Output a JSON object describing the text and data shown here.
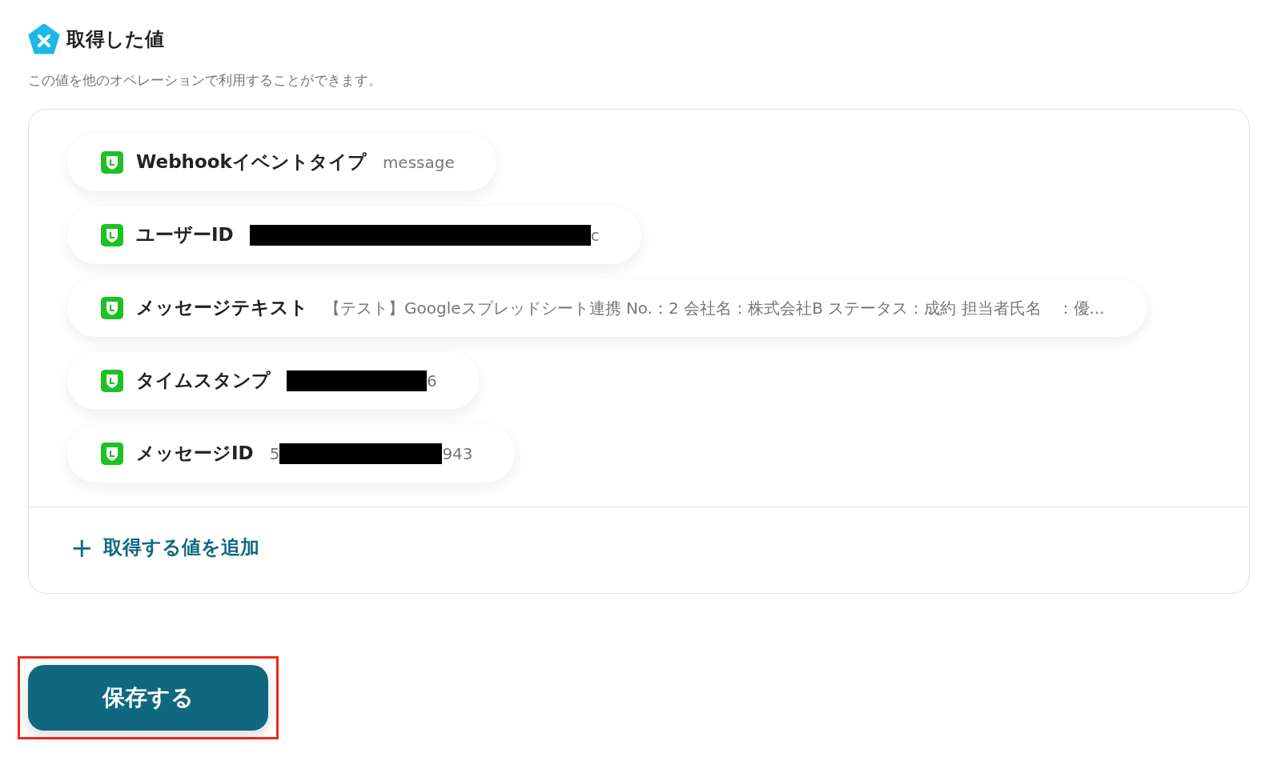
{
  "section": {
    "title": "取得した値",
    "description": "この値を他のオペレーションで利用することができます。"
  },
  "values": [
    {
      "label": "Webhookイベントタイプ",
      "parts": [
        {
          "kind": "text",
          "text": "message"
        }
      ]
    },
    {
      "label": "ユーザーID",
      "parts": [
        {
          "kind": "redacted"
        },
        {
          "kind": "text",
          "text": "c"
        }
      ]
    },
    {
      "label": "メッセージテキスト",
      "parts": [
        {
          "kind": "text",
          "text": "【テスト】Googleスプレッドシート連携 No.：2 会社名：株式会社B ステータス：成約 担当者氏名　：優..."
        }
      ]
    },
    {
      "label": "タイムスタンプ",
      "parts": [
        {
          "kind": "redacted"
        },
        {
          "kind": "text",
          "text": "6"
        }
      ]
    },
    {
      "label": "メッセージID",
      "parts": [
        {
          "kind": "text",
          "text": "5"
        },
        {
          "kind": "redacted"
        },
        {
          "kind": "text",
          "text": "943"
        }
      ]
    }
  ],
  "add_link": {
    "icon": "+",
    "label": "取得する値を追加"
  },
  "save_button": {
    "label": "保存する",
    "highlighted": true
  }
}
